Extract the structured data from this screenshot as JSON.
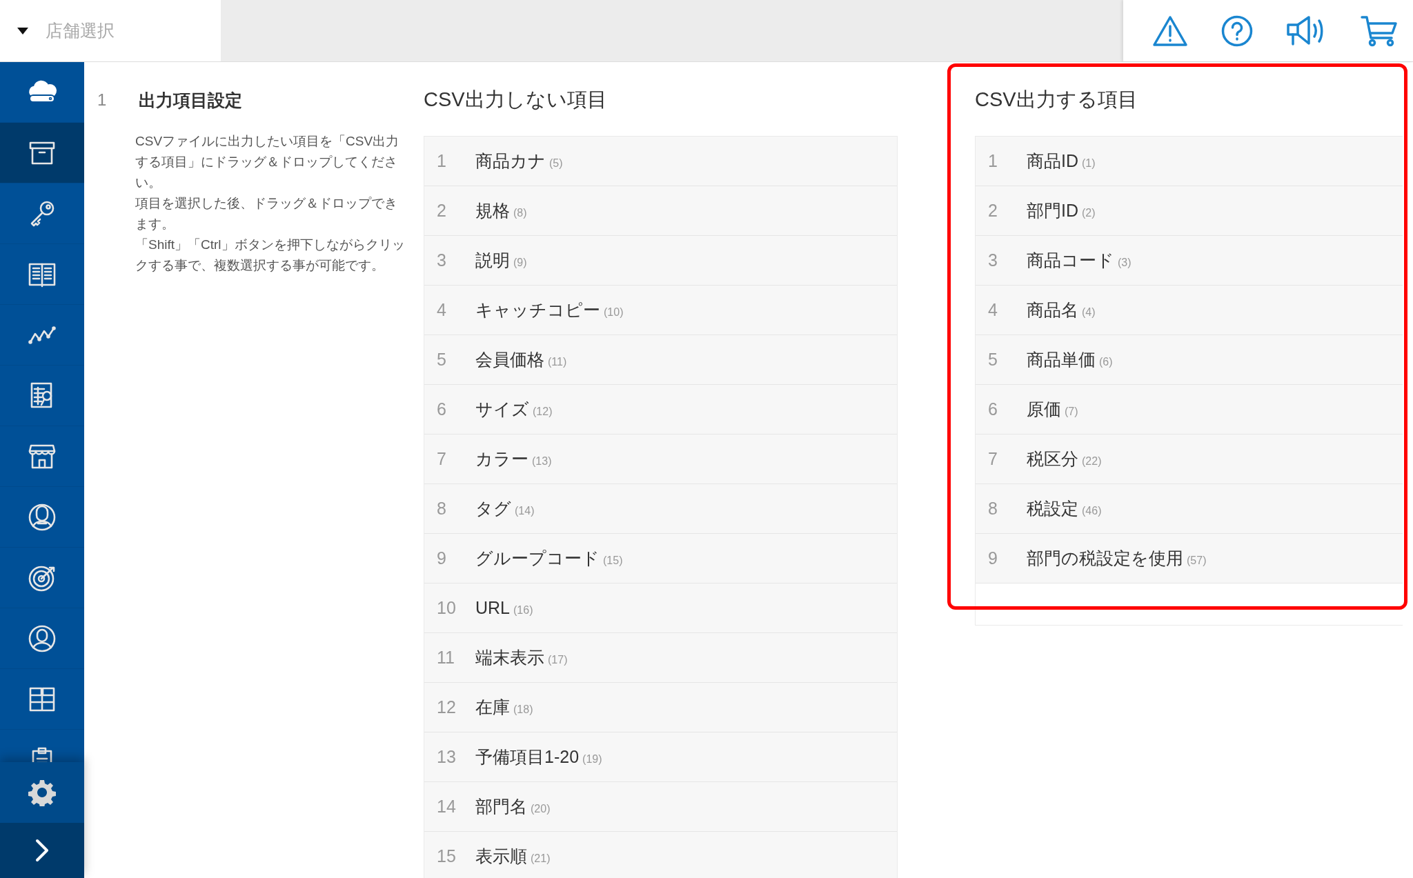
{
  "store_select": {
    "placeholder": "店舗選択"
  },
  "sidebar": {
    "items": [
      {
        "selected": false
      },
      {
        "selected": true
      },
      {
        "selected": false
      },
      {
        "selected": false
      },
      {
        "selected": false
      },
      {
        "selected": false
      },
      {
        "selected": false
      },
      {
        "selected": false
      },
      {
        "selected": false
      },
      {
        "selected": false
      },
      {
        "selected": false
      },
      {
        "selected": false
      }
    ]
  },
  "step": {
    "number": "1",
    "title": "出力項目設定",
    "description": [
      "CSVファイルに出力したい項目を「CSV出力する項目」にドラッグ＆ドロップしてください。",
      "項目を選択した後、ドラッグ＆ドロップできます。",
      "「Shift」「Ctrl」ボタンを押下しながらクリックする事で、複数選択する事が可能です。"
    ]
  },
  "excluded": {
    "title": "CSV出力しない項目",
    "rows": [
      {
        "number": "1",
        "label": "商品カナ",
        "code": "(5)"
      },
      {
        "number": "2",
        "label": "規格",
        "code": "(8)"
      },
      {
        "number": "3",
        "label": "説明",
        "code": "(9)"
      },
      {
        "number": "4",
        "label": "キャッチコピー",
        "code": "(10)"
      },
      {
        "number": "5",
        "label": "会員価格",
        "code": "(11)"
      },
      {
        "number": "6",
        "label": "サイズ",
        "code": "(12)"
      },
      {
        "number": "7",
        "label": "カラー",
        "code": "(13)"
      },
      {
        "number": "8",
        "label": "タグ",
        "code": "(14)"
      },
      {
        "number": "9",
        "label": "グループコード",
        "code": "(15)"
      },
      {
        "number": "10",
        "label": "URL",
        "code": "(16)"
      },
      {
        "number": "11",
        "label": "端末表示",
        "code": "(17)"
      },
      {
        "number": "12",
        "label": "在庫",
        "code": "(18)"
      },
      {
        "number": "13",
        "label": "予備項目1-20",
        "code": "(19)"
      },
      {
        "number": "14",
        "label": "部門名",
        "code": "(20)"
      },
      {
        "number": "15",
        "label": "表示順",
        "code": "(21)"
      }
    ]
  },
  "included": {
    "title": "CSV出力する項目",
    "highlighted": true,
    "rows": [
      {
        "number": "1",
        "label": "商品ID",
        "code": "(1)"
      },
      {
        "number": "2",
        "label": "部門ID",
        "code": "(2)"
      },
      {
        "number": "3",
        "label": "商品コード",
        "code": "(3)"
      },
      {
        "number": "4",
        "label": "商品名",
        "code": "(4)"
      },
      {
        "number": "5",
        "label": "商品単価",
        "code": "(6)"
      },
      {
        "number": "6",
        "label": "原価",
        "code": "(7)"
      },
      {
        "number": "7",
        "label": "税区分",
        "code": "(22)"
      },
      {
        "number": "8",
        "label": "税設定",
        "code": "(46)"
      },
      {
        "number": "9",
        "label": "部門の税設定を使用",
        "code": "(57)"
      }
    ]
  }
}
